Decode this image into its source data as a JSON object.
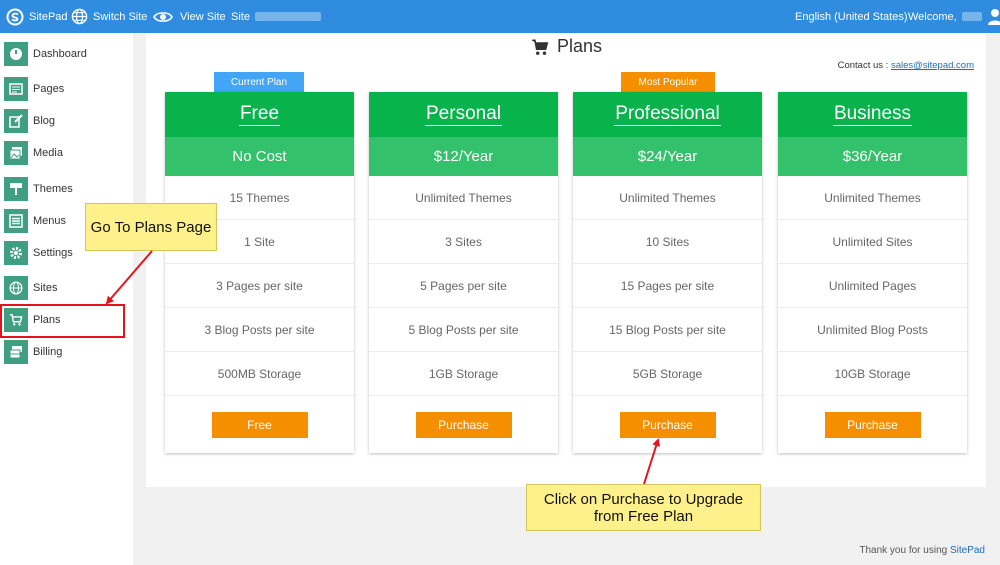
{
  "topbar": {
    "brand": "SitePad",
    "switch_site": "Switch Site",
    "view_site": "View Site",
    "site_label": "Site",
    "language": "English (United States)",
    "welcome": "Welcome,"
  },
  "sidebar": {
    "items": [
      {
        "label": "Dashboard",
        "icon": "dashboard-icon"
      },
      {
        "label": "Pages",
        "icon": "pages-icon"
      },
      {
        "label": "Blog",
        "icon": "blog-icon"
      },
      {
        "label": "Media",
        "icon": "media-icon"
      },
      {
        "label": "Themes",
        "icon": "themes-icon"
      },
      {
        "label": "Menus",
        "icon": "menus-icon"
      },
      {
        "label": "Settings",
        "icon": "settings-icon"
      },
      {
        "label": "Sites",
        "icon": "globe-icon"
      },
      {
        "label": "Plans",
        "icon": "cart-icon"
      },
      {
        "label": "Billing",
        "icon": "billing-icon"
      }
    ]
  },
  "main": {
    "title": "Plans",
    "contact_label": "Contact us :",
    "contact_email": "sales@sitepad.com"
  },
  "plans": [
    {
      "name": "Free",
      "price": "No Cost",
      "ribbon": "Current Plan",
      "features": [
        "15 Themes",
        "1 Site",
        "3 Pages per site",
        "3 Blog Posts per site",
        "500MB Storage"
      ],
      "button": "Free"
    },
    {
      "name": "Personal",
      "price": "$12/Year",
      "ribbon": "",
      "features": [
        "Unlimited Themes",
        "3 Sites",
        "5 Pages per site",
        "5 Blog Posts per site",
        "1GB Storage"
      ],
      "button": "Purchase"
    },
    {
      "name": "Professional",
      "price": "$24/Year",
      "ribbon": "Most Popular",
      "features": [
        "Unlimited Themes",
        "10 Sites",
        "15 Pages per site",
        "15 Blog Posts per site",
        "5GB Storage"
      ],
      "button": "Purchase"
    },
    {
      "name": "Business",
      "price": "$36/Year",
      "ribbon": "",
      "features": [
        "Unlimited Themes",
        "Unlimited Sites",
        "Unlimited Pages",
        "Unlimited Blog Posts",
        "10GB Storage"
      ],
      "button": "Purchase"
    }
  ],
  "annotations": {
    "plans_note": "Go To Plans Page",
    "purchase_note": "Click on Purchase to Upgrade from Free Plan"
  },
  "footer": {
    "text": "Thank you for using",
    "link": "SitePad"
  },
  "colors": {
    "topbar": "#2f8cdf",
    "sidebar_icon": "#3f9f80",
    "plan_header": "#08b34b",
    "plan_price": "#33c26b",
    "button": "#f58f00",
    "ribbon_current": "#42a5f5",
    "ribbon_popular": "#f58f00",
    "annotation": "#fef08a",
    "highlight": "#e3141c"
  }
}
